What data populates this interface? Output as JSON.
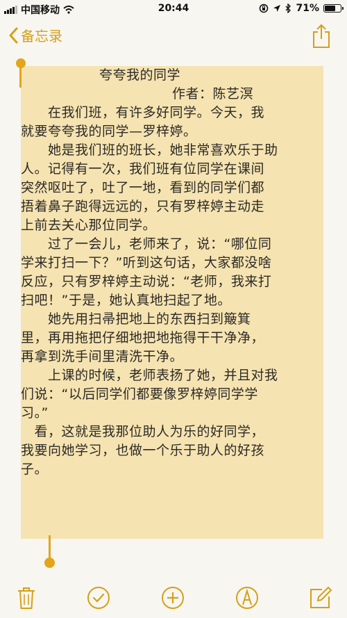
{
  "status_bar": {
    "carrier": "中国移动",
    "time": "20:44",
    "battery": "71%",
    "battery_level": 0.71
  },
  "nav": {
    "back_label": "备忘录"
  },
  "note": {
    "title": "夸夸我的同学",
    "author": "作者：陈艺溟",
    "lines": [
      "　　在我们班，有许多好同学。今天，我",
      "就要夸夸我的同学—罗梓婷。",
      "　　她是我们班的班长，她非常喜欢乐于助",
      "人。记得有一次，我们班有位同学在课间",
      "突然呕吐了，吐了一地，看到的同学们都",
      "捂着鼻子跑得远远的，只有罗梓婷主动走",
      "上前去关心那位同学。",
      "　　过了一会儿，老师来了，说：“哪位同",
      "学来打扫一下？”听到这句话，大家都没啥",
      "反应，只有罗梓婷主动说：“老师，我来打",
      "扫吧！”于是，她认真地扫起了地。",
      "　　她先用扫帚把地上的东西扫到簸箕",
      "里，再用拖把仔细地把地拖得干干净净，",
      "再拿到洗手间里清洗干净。",
      "　　上课的时候，老师表扬了她，并且对我",
      "们说：“以后同学们都要像罗梓婷同学学",
      "习。”",
      "　看，这就是我那位助人为乐的好同学，",
      "我要向她学习，也做一个乐于助人的好孩",
      "子。"
    ]
  },
  "toolbar": {
    "items": [
      "trash-icon",
      "checklist-icon",
      "add-icon",
      "markup-icon",
      "compose-icon"
    ],
    "accent_color": "#d4a017"
  }
}
